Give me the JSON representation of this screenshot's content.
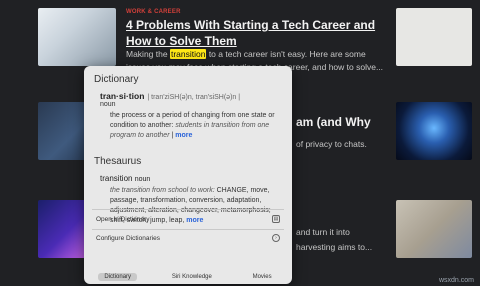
{
  "article": {
    "category": "WORK & CAREER",
    "headline": "4 Problems With Starting a Tech Career and How to Solve Them",
    "excerpt_before": "Making the ",
    "excerpt_highlight": "transition",
    "excerpt_after": " to a tech career isn't easy. Here are some issues you may face when starting a tech career, and how to solve..."
  },
  "background_fragments": {
    "headline2_tail": "am (and Why",
    "excerpt2_tail": "of privacy to chats.",
    "excerpt3_line1": "and turn it into",
    "excerpt3_line2": "harvesting aims to..."
  },
  "popup": {
    "dictionary_title": "Dictionary",
    "headword": "tran·si·tion",
    "pronunciation": "| tran'ziSH(ə)n, tran'siSH(ə)n |",
    "pos": "noun",
    "definition": "the process or a period of changing from one state or condition to another:",
    "definition_example": "students in transition from one program to another",
    "more_label": "more",
    "thesaurus_title": "Thesaurus",
    "thes_word": "transition",
    "thes_pos": "noun",
    "thes_example": "the transition from school to work:",
    "thes_synonyms": "CHANGE, move, passage, transformation, conversion, adaptation, adjustment, alteration, changeover, metamorphosis; shift, switch, jump, leap,",
    "actions": [
      {
        "label": "Open in Dictionary",
        "icon": "book-icon"
      },
      {
        "label": "Configure Dictionaries",
        "icon": "settings-circle-icon"
      }
    ],
    "tabs": [
      {
        "label": "Dictionary",
        "active": true
      },
      {
        "label": "Siri Knowledge",
        "active": false
      },
      {
        "label": "Movies",
        "active": false
      }
    ]
  },
  "watermark": "wsxdn.com",
  "colors": {
    "background": "#202124",
    "category": "#d2403a",
    "highlight": "#ffe817",
    "more_link": "#2a63d9",
    "popup_bg": "#e8e8e8"
  }
}
